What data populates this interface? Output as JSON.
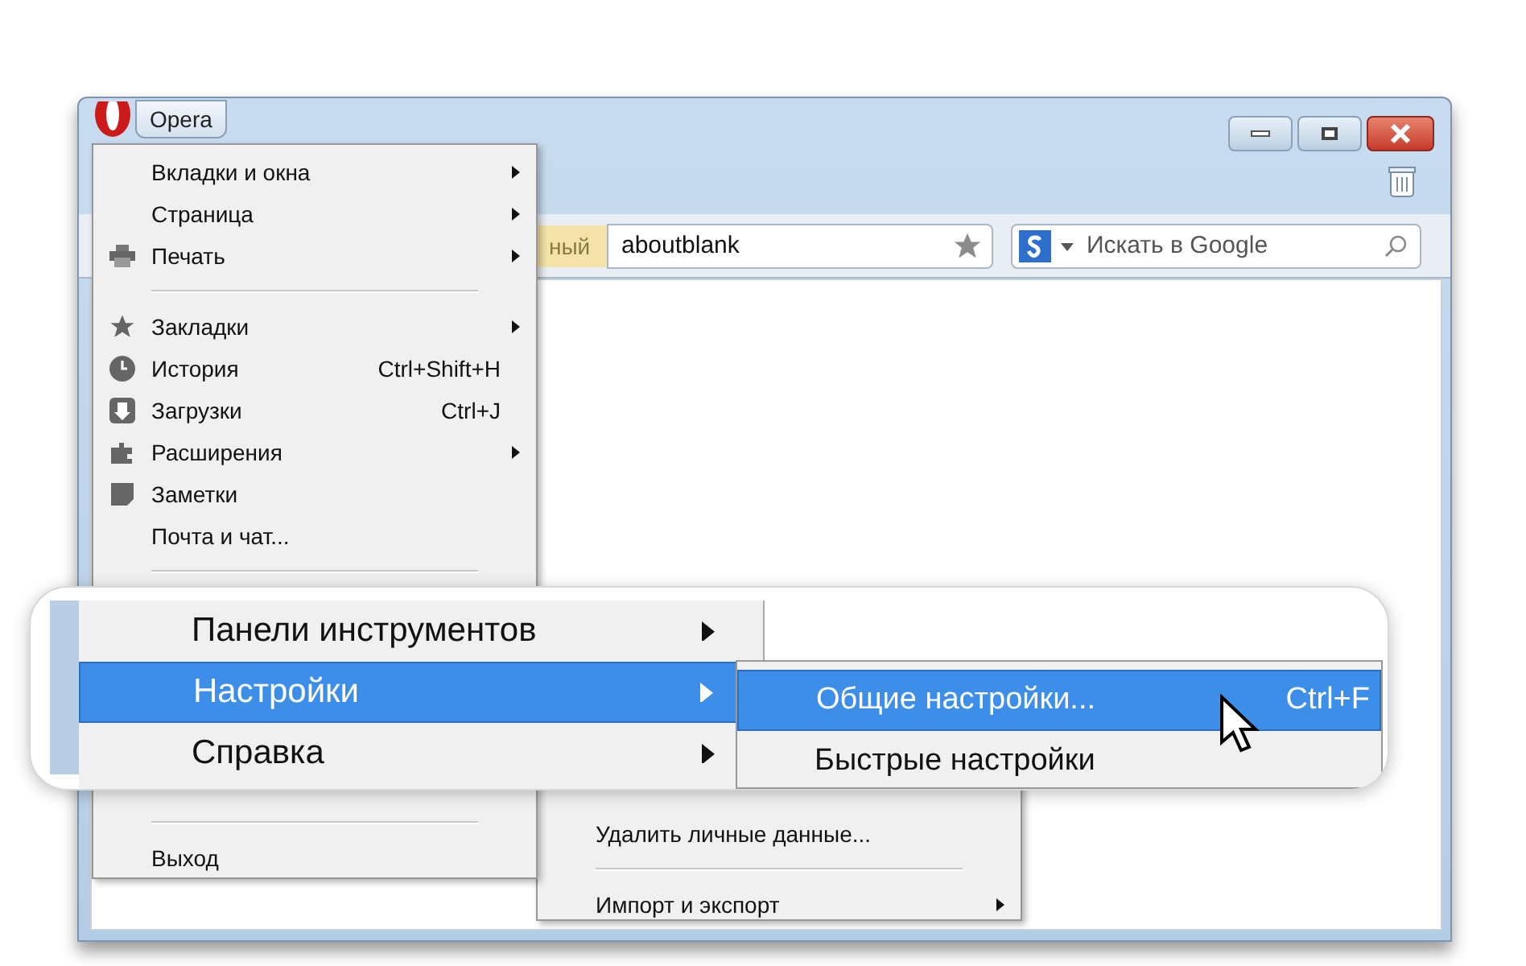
{
  "window": {
    "menu_button": "Opera"
  },
  "toolbar": {
    "address_prefix": "ный",
    "address": "aboutblank",
    "search": {
      "placeholder": "Искать в Google"
    }
  },
  "menu": {
    "items": [
      {
        "kind": "item",
        "label": "Вкладки и окна",
        "submenu": true
      },
      {
        "kind": "item",
        "label": "Страница",
        "submenu": true
      },
      {
        "kind": "item",
        "label": "Печать",
        "submenu": true
      },
      {
        "kind": "separator"
      },
      {
        "kind": "item",
        "label": "Закладки",
        "submenu": true
      },
      {
        "kind": "item",
        "label": "История",
        "shortcut": "Ctrl+Shift+H"
      },
      {
        "kind": "item",
        "label": "Загрузки",
        "shortcut": "Ctrl+J"
      },
      {
        "kind": "item",
        "label": "Расширения",
        "submenu": true
      },
      {
        "kind": "item",
        "label": "Заметки"
      },
      {
        "kind": "item",
        "label": "Почта и чат..."
      },
      {
        "kind": "separator"
      }
    ],
    "bottom_items": [
      {
        "kind": "separator"
      },
      {
        "kind": "item",
        "label": "Выход"
      }
    ]
  },
  "submenu": {
    "items": [
      {
        "kind": "item",
        "label": "Удалить личные данные..."
      },
      {
        "kind": "separator"
      },
      {
        "kind": "item",
        "label": "Импорт и экспорт",
        "submenu": true
      }
    ]
  },
  "magnifier": {
    "rows": [
      {
        "label": "Панели инструментов",
        "submenu": true,
        "selected": false
      },
      {
        "label": "Настройки",
        "submenu": true,
        "selected": true
      },
      {
        "label": "Справка",
        "submenu": true,
        "selected": false
      }
    ],
    "submenu": [
      {
        "label": "Общие настройки...",
        "shortcut": "Ctrl+F",
        "selected": true
      },
      {
        "label": "Быстрые настройки",
        "selected": false
      }
    ]
  }
}
